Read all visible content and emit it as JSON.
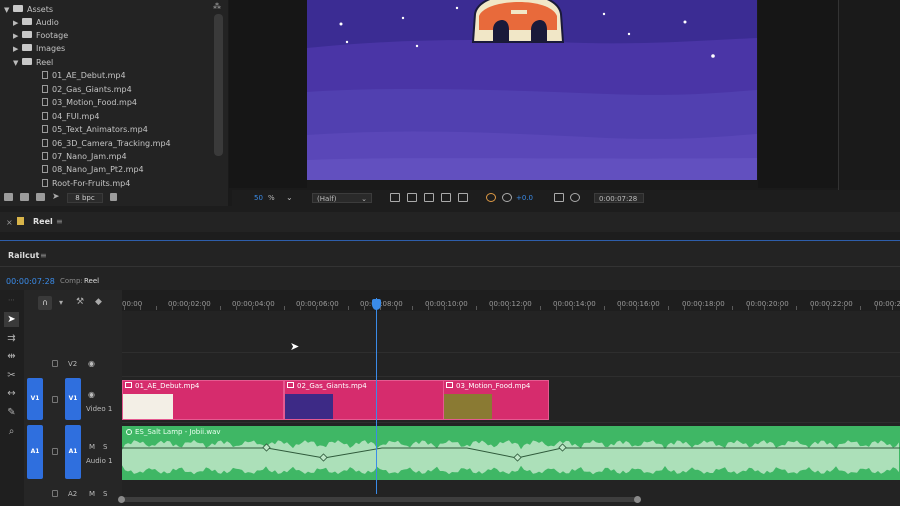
{
  "project": {
    "root": "Assets",
    "folders": [
      "Audio",
      "Footage",
      "Images",
      "Reel"
    ],
    "files": [
      "01_AE_Debut.mp4",
      "02_Gas_Giants.mp4",
      "03_Motion_Food.mp4",
      "04_FUI.mp4",
      "05_Text_Animators.mp4",
      "06_3D_Camera_Tracking.mp4",
      "07_Nano_Jam.mp4",
      "08_Nano_Jam_Pt2.mp4",
      "Root-For-Fruits.mp4"
    ],
    "bpc": "8 bpc"
  },
  "monitor": {
    "zoom": "50",
    "zoom_unit": "%",
    "resolution": "(Half)",
    "exposure": "+0.0",
    "timecode": "0:00:07:28"
  },
  "reel_tab": {
    "label": "Reel"
  },
  "timeline": {
    "panel_label": "Railcut",
    "timecode": "00:00:07:28",
    "breadcrumb_prefix": "Comp:",
    "breadcrumb": "Reel",
    "ruler": [
      "00:00",
      "00:00:02:00",
      "00:00:04:00",
      "00:00:06:00",
      "00:00:08:00",
      "00:00:10:00",
      "00:00:12:00",
      "00:00:14:00",
      "00:00:16:00",
      "00:00:18:00",
      "00:00:20:00",
      "00:00:22:00",
      "00:00:24"
    ],
    "tracks": {
      "v2": "V2",
      "v1_src": "V1",
      "v1": "V1",
      "v1_name": "Video 1",
      "a1_src": "A1",
      "a1": "A1",
      "a1_name": "Audio 1",
      "a2": "A2",
      "m": "M",
      "s": "S"
    },
    "video_clips": [
      "01_AE_Debut.mp4",
      "02_Gas_Giants.mp4",
      "03_Motion_Food.mp4"
    ],
    "audio_clip": "ES_Salt Lamp - Jobii.wav"
  },
  "colors": {
    "video_clip": "#d62c6d",
    "audio_clip": "#3fb765",
    "track_button": "#2f6fde",
    "playhead": "#3a8be8",
    "timecode": "#3a8be8"
  }
}
